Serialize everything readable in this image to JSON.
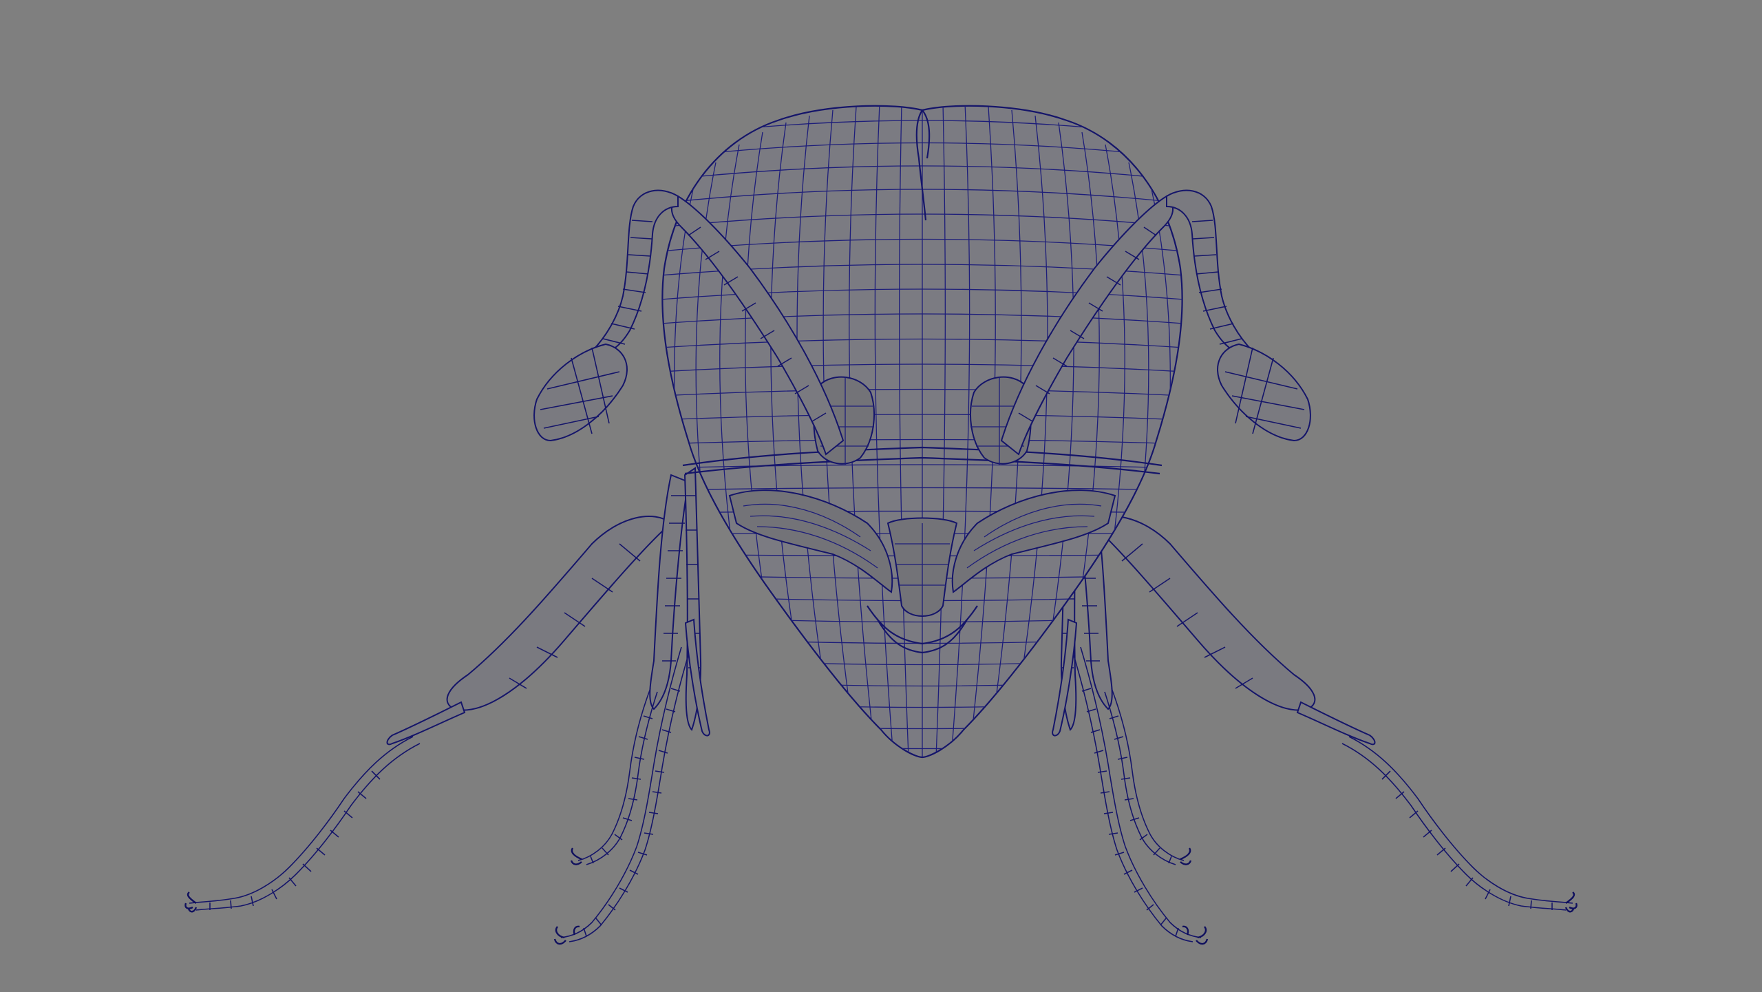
{
  "viewport": {
    "background": "#7f7f7f",
    "wireframe_color": "#1d1d7a",
    "render_mode": "wireframe-on-shaded",
    "subject": "ant-head-model"
  }
}
